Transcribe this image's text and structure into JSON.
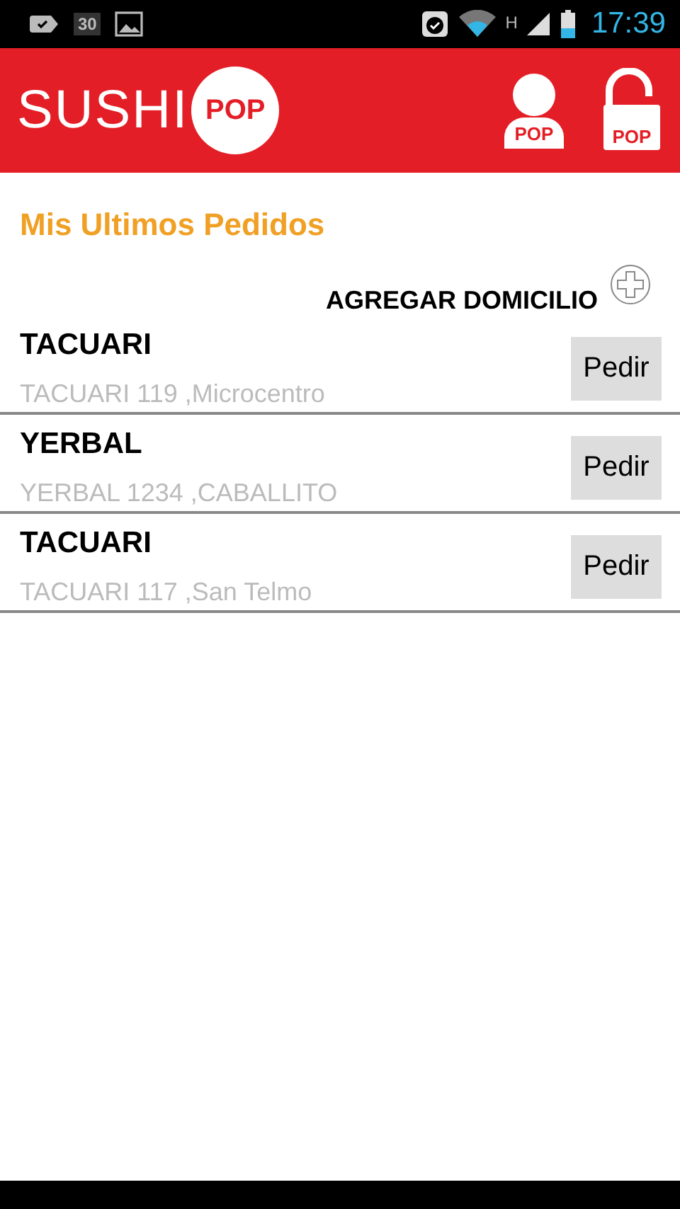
{
  "status_bar": {
    "notification_badge": "30",
    "network_type": "H",
    "time": "17:39"
  },
  "header": {
    "logo_text": "SUSHI",
    "logo_badge": "POP",
    "profile_badge": "POP",
    "lock_badge": "POP"
  },
  "title": "Mis Ultimos Pedidos",
  "add_address": {
    "label": "AGREGAR DOMICILIO"
  },
  "addresses": [
    {
      "name": "TACUARI",
      "address": "TACUARI 119 ,Microcentro",
      "button": "Pedir"
    },
    {
      "name": "YERBAL",
      "address": "YERBAL 1234 ,CABALLITO",
      "button": "Pedir"
    },
    {
      "name": "TACUARI",
      "address": "TACUARI 117 ,San Telmo",
      "button": "Pedir"
    }
  ]
}
